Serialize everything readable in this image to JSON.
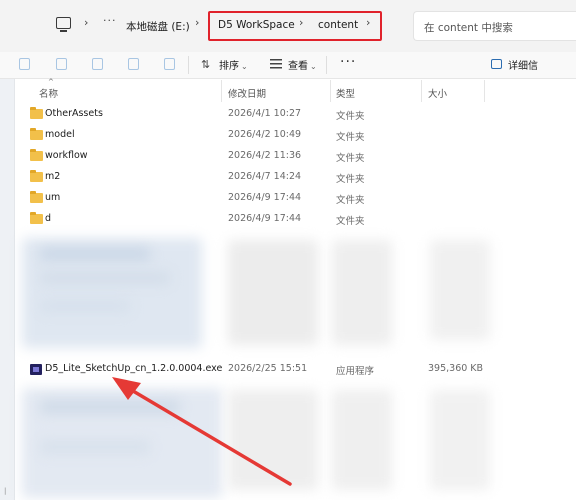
{
  "address_bar": {
    "chevron": "›",
    "more": "···",
    "drive": "本地磁盘 (E:)",
    "folder1": "D5 WorkSpace",
    "folder2": "content",
    "search_placeholder": "在 content 中搜索"
  },
  "toolbar": {
    "sort_label": "排序",
    "view_label": "查看",
    "more": "···",
    "details_label": "详细信",
    "caret": "⌄"
  },
  "columns": {
    "name": "名称",
    "date": "修改日期",
    "type": "类型",
    "size": "大小"
  },
  "rows": [
    {
      "name": "OtherAssets",
      "date": "2026/4/1 10:27",
      "type": "文件夹",
      "size": ""
    },
    {
      "name": "model",
      "date": "2026/4/2 10:49",
      "type": "文件夹",
      "size": ""
    },
    {
      "name": "workflow",
      "date": "2026/4/2 11:36",
      "type": "文件夹",
      "size": ""
    },
    {
      "name": "m2",
      "date": "2026/4/7 14:24",
      "type": "文件夹",
      "size": ""
    },
    {
      "name": "um",
      "date": "2026/4/9 17:44",
      "type": "文件夹",
      "size": ""
    },
    {
      "name": "d",
      "date": "2026/4/9 17:44",
      "type": "文件夹",
      "size": ""
    }
  ],
  "exe_row": {
    "name": "D5_Lite_SketchUp_cn_1.2.0.0004.exe",
    "date": "2026/2/25 15:51",
    "type": "应用程序",
    "size": "395,360 KB"
  },
  "colors": {
    "highlight": "#e0222b",
    "folder": "#f2c04a",
    "arrow": "#e53935"
  },
  "icons": {
    "computer": "monitor-icon",
    "folder": "folder-icon",
    "exe": "application-icon",
    "details": "details-pane-icon"
  }
}
